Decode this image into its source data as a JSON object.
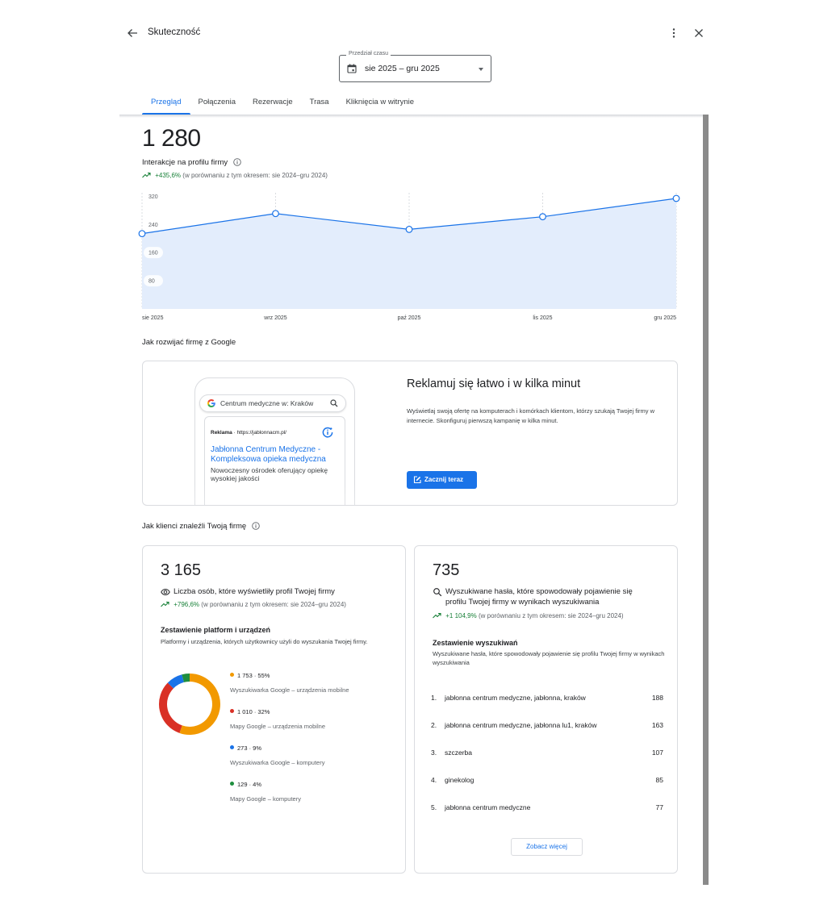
{
  "header": {
    "title": "Skuteczność",
    "date_range_label": "Przedział czasu",
    "date_range_value": "sie 2025 – gru 2025"
  },
  "tabs": [
    {
      "label": "Przegląd",
      "active": true
    },
    {
      "label": "Połączenia",
      "active": false
    },
    {
      "label": "Rezerwacje",
      "active": false
    },
    {
      "label": "Trasa",
      "active": false
    },
    {
      "label": "Kliknięcia w witrynie",
      "active": false
    }
  ],
  "summary": {
    "total": "1 280",
    "label": "Interakcje na profilu firmy",
    "change_pct": "+435,6%",
    "change_note": "(w porównaniu z tym okresem: sie 2024–gru 2024)"
  },
  "chart_data": {
    "type": "area",
    "categories": [
      "sie 2025",
      "wrz 2025",
      "paź 2025",
      "lis 2025",
      "gru 2025"
    ],
    "series": [
      {
        "values": [
          214,
          271,
          226,
          262,
          314
        ]
      }
    ],
    "ylim": [
      0,
      330
    ],
    "y_ticks": [
      "320",
      "240",
      "160",
      "80"
    ],
    "color": "#1a73e8",
    "fill": "#e3edfc",
    "grid": true
  },
  "grow": {
    "title": "Jak rozwijać firmę z Google",
    "phone": {
      "search_text": "Centrum medyczne w: Kraków",
      "ad_label": "Reklama",
      "ad_url": "https://jablonnacm.pl/",
      "ad_title": "Jabłonna Centrum Medyczne - Kompleksowa opieka medyczna",
      "ad_desc": "Nowoczesny ośrodek oferujący opiekę wysokiej jakości"
    },
    "heading": "Reklamuj się łatwo i w kilka minut",
    "text": "Wyświetlaj swoją ofertę na komputerach i komórkach klientom, którzy szukają Twojej firmy w internecie. Skonfiguruj pierwszą kampanię w kilka minut.",
    "button": "Zacznij teraz"
  },
  "found": {
    "title": "Jak klienci znaleźli Twoją firmę",
    "views": {
      "total": "3 165",
      "label": "Liczba osób, które wyświetliły profil Twojej firmy",
      "change_pct": "+796,6%",
      "change_note": "(w porównaniu z tym okresem: sie 2024–gru 2024)",
      "section_title": "Zestawienie platform i urządzeń",
      "section_desc": "Platformy i urządzenia, których użytkownicy użyli do wyszukania Twojej firmy.",
      "platforms": [
        {
          "value": "1 753 · 55%",
          "name": "Wyszukiwarka Google – urządzenia mobilne",
          "count": 1753,
          "color": "#f29900"
        },
        {
          "value": "1 010 · 32%",
          "name": "Mapy Google – urządzenia mobilne",
          "count": 1010,
          "color": "#d93025"
        },
        {
          "value": "273 · 9%",
          "name": "Wyszukiwarka Google – komputery",
          "count": 273,
          "color": "#1a73e8"
        },
        {
          "value": "129 · 4%",
          "name": "Mapy Google – komputery",
          "count": 129,
          "color": "#1e8e3e"
        }
      ]
    },
    "searches": {
      "total": "735",
      "label": "Wyszukiwane hasła, które spowodowały pojawienie się profilu Twojej firmy w wynikach wyszukiwania",
      "change_pct": "+1 104,9%",
      "change_note": "(w porównaniu z tym okresem: sie 2024–gru 2024)",
      "section_title": "Zestawienie wyszukiwań",
      "section_desc": "Wyszukiwane hasła, które spowodowały pojawienie się profilu Twojej firmy w wynikach wyszukiwania",
      "queries": [
        {
          "idx": "1.",
          "text": "jabłonna centrum medyczne, jabłonna, kraków",
          "count": "188"
        },
        {
          "idx": "2.",
          "text": "jabłonna centrum medyczne, jabłonna lu1, kraków",
          "count": "163"
        },
        {
          "idx": "3.",
          "text": "szczerba",
          "count": "107"
        },
        {
          "idx": "4.",
          "text": "ginekolog",
          "count": "85"
        },
        {
          "idx": "5.",
          "text": "jabłonna centrum medyczne",
          "count": "77"
        }
      ],
      "more_button": "Zobacz więcej"
    }
  }
}
